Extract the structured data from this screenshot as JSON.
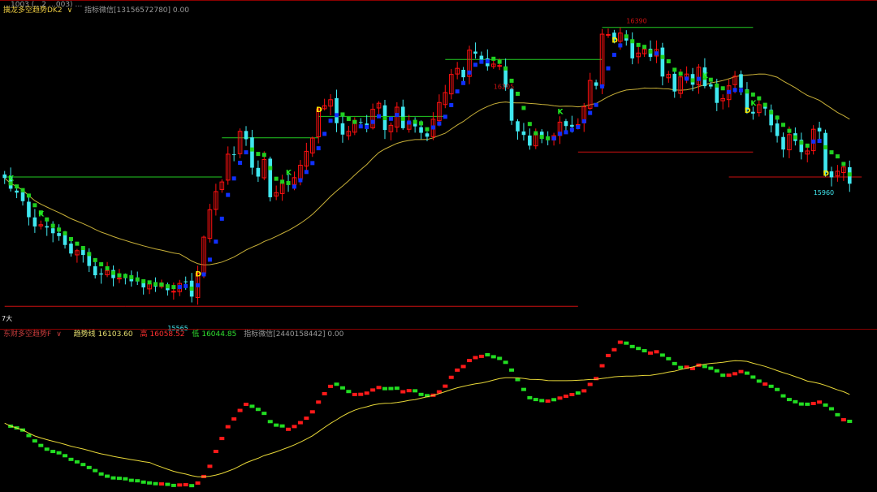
{
  "top_panel": {
    "header_line0": "…1003  (…2  …003) …",
    "indicator_name": "擒龙多空趋势DK2",
    "chevron": "∨",
    "wechat_label": "指标微信[13156572780] 0.00"
  },
  "bottom_panel": {
    "indicator_name": "东财多空趋势F",
    "chevron": "∨",
    "trend_label": "趋势线",
    "trend_value": "16103.60",
    "high_label": "高",
    "high_value": "16058.52",
    "low_label": "低",
    "low_value": "16044.85",
    "wechat_label": "指标微信[2440158442] 0.00"
  },
  "colors": {
    "background": "#000000",
    "up_candle": "#ff1010",
    "down_candle": "#40e8f0",
    "trend_up": "#1030ff",
    "trend_down": "#20d020",
    "resistance": "#22cc22",
    "support": "#cc1111",
    "ma_line": "#c8b038",
    "signal_k": "#22ee22",
    "signal_d": "#ffee00",
    "separator": "#8a0000"
  },
  "chart_data": [
    {
      "type": "candlestick",
      "annotations": {
        "high_label": "16390",
        "mid_high_label": "16205",
        "low_label": "15565",
        "right_low_label": "15960",
        "left_label": "7大"
      },
      "y_range": [
        15560,
        16440
      ],
      "signals_k": [
        "K",
        "K",
        "K",
        "K",
        "K",
        "K"
      ],
      "signals_d": [
        "D",
        "D",
        "D",
        "D",
        "D"
      ],
      "closes": [
        15972,
        15942,
        15931,
        15907,
        15862,
        15836,
        15841,
        15833,
        15817,
        15809,
        15784,
        15760,
        15768,
        15756,
        15725,
        15699,
        15701,
        15712,
        15691,
        15691,
        15691,
        15682,
        15682,
        15665,
        15675,
        15667,
        15676,
        15657,
        15654,
        15676,
        15681,
        15639,
        15705,
        15806,
        15883,
        15934,
        15961,
        16039,
        16037,
        16103,
        16081,
        16001,
        15976,
        16024,
        15918,
        15931,
        15959,
        15958,
        15973,
        16008,
        16047,
        16084,
        16166,
        16175,
        16192,
        16126,
        16094,
        16103,
        16133,
        16129,
        16118,
        16165,
        16182,
        16107,
        16120,
        16171,
        16112,
        16129,
        16117,
        16099,
        16088,
        16137,
        16184,
        16212,
        16263,
        16280,
        16255,
        16331,
        16321,
        16305,
        16286,
        16292,
        16288,
        16227,
        16133,
        16103,
        16093,
        16063,
        16097,
        16082,
        16083,
        16091,
        16129,
        16118,
        16116,
        16122,
        16172,
        16246,
        16231,
        16376,
        16375,
        16361,
        16379,
        16358,
        16308,
        16323,
        16334,
        16312,
        16333,
        16257,
        16263,
        16215,
        16256,
        16264,
        16234,
        16283,
        16230,
        16229,
        16183,
        16195,
        16231,
        16258,
        16226,
        16164,
        16153,
        16178,
        16167,
        16120,
        16090,
        16052,
        16094,
        16076,
        16045,
        16048,
        16109,
        16103,
        15987,
        15974,
        15991,
        16003,
        15956
      ]
    },
    {
      "type": "line",
      "series": [
        {
          "name": "趋势线",
          "values_ref": "trend step line (red/green)"
        },
        {
          "name": "MA",
          "values_ref": "yellow moving average"
        }
      ]
    }
  ]
}
